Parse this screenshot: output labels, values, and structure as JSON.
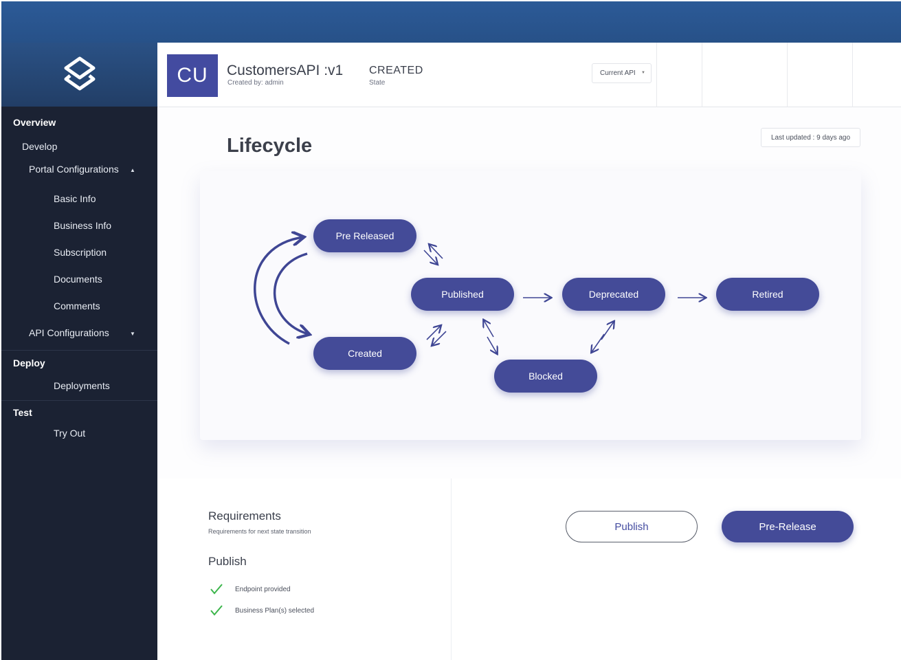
{
  "sidebar": {
    "items": [
      {
        "label": "Overview"
      },
      {
        "label": "Develop"
      },
      {
        "label": "Portal Configurations"
      },
      {
        "label": "Basic Info"
      },
      {
        "label": "Business Info"
      },
      {
        "label": "Subscription"
      },
      {
        "label": "Documents"
      },
      {
        "label": "Comments"
      },
      {
        "label": "API Configurations"
      },
      {
        "label": "Deploy"
      },
      {
        "label": "Deployments"
      },
      {
        "label": "Test"
      },
      {
        "label": "Try Out"
      }
    ]
  },
  "header": {
    "avatar_initials": "CU",
    "api_name": "CustomersAPI :v1",
    "created_by": "Created by: admin",
    "state_value": "CREATED",
    "state_label": "State",
    "api_selector": "Current API"
  },
  "main": {
    "title": "Lifecycle",
    "last_updated": "Last updated : 9 days ago"
  },
  "lifecycle": {
    "states": [
      "Pre Released",
      "Published",
      "Deprecated",
      "Retired",
      "Created",
      "Blocked"
    ],
    "node_color": "#444b98"
  },
  "requirements": {
    "title": "Requirements",
    "subtitle": "Requirements for next state transition",
    "section": "Publish",
    "checks": [
      "Endpoint provided",
      "Business Plan(s) selected"
    ],
    "check_color": "#3bb54a"
  },
  "actions": {
    "publish": "Publish",
    "pre_release": "Pre-Release"
  }
}
